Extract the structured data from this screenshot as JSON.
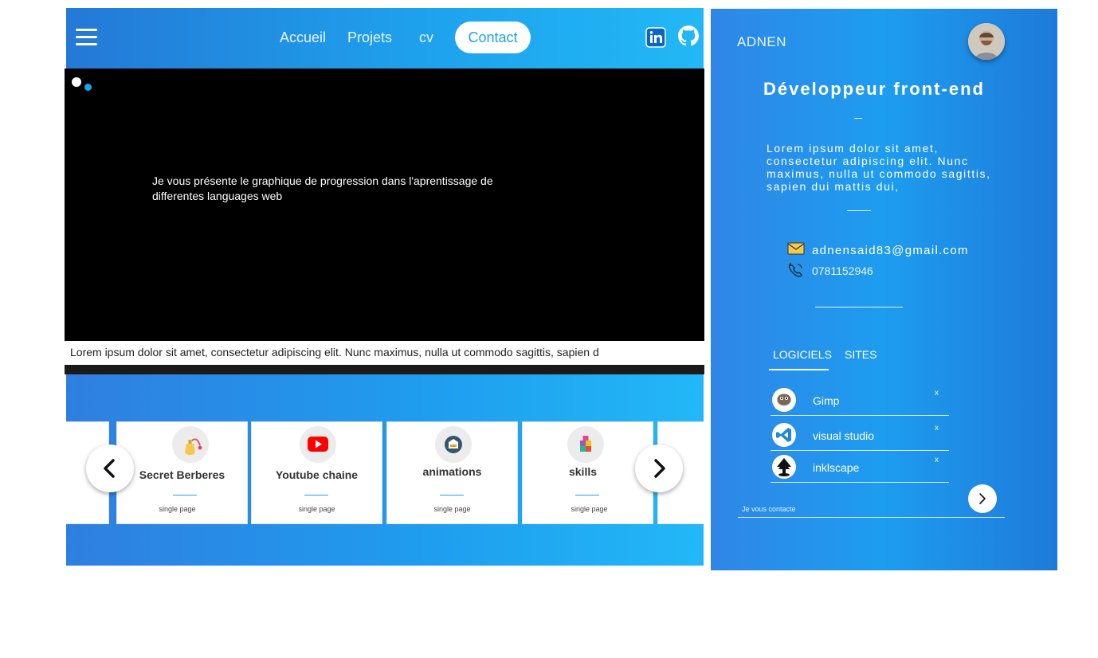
{
  "nav": {
    "links": [
      "Accueil",
      "Projets",
      "cv"
    ],
    "contact_label": "Contact",
    "social": [
      "linkedin-icon",
      "github-icon"
    ]
  },
  "video": {
    "text": "Je vous présente le graphique de progression dans l'aprentissage de differentes languages web",
    "caption": "Lorem ipsum dolor sit amet, consectetur adipiscing elit. Nunc maximus, nulla ut commodo sagittis, sapien d"
  },
  "carousel": {
    "cards": [
      {
        "title": "Secret Berberes",
        "subtitle": "single page",
        "icon": "perfume-icon"
      },
      {
        "title": "Youtube chaine",
        "subtitle": "single page",
        "icon": "youtube-icon"
      },
      {
        "title": "animations",
        "subtitle": "single page",
        "icon": "box-icon"
      },
      {
        "title": "skills",
        "subtitle": "single page",
        "icon": "blocks-icon"
      }
    ]
  },
  "profile": {
    "brand": "ADNEN",
    "role": "Développeur front-end",
    "bio": "Lorem ipsum dolor sit amet, consectetur adipiscing elit. Nunc maximus, nulla ut commodo sagittis, sapien dui mattis dui,",
    "email": "adnensaid83@gmail.com",
    "phone": "0781152946"
  },
  "tabs": [
    "LOGICIELS",
    "SITES"
  ],
  "software": [
    {
      "name": "Gimp",
      "remove": "x",
      "icon": "gimp-icon"
    },
    {
      "name": "visual studio",
      "remove": "x",
      "icon": "vscode-icon"
    },
    {
      "name": "inklscape",
      "remove": "x",
      "icon": "inkscape-icon"
    }
  ],
  "contact": {
    "placeholder": "Je vous contacte"
  },
  "colors": {
    "accent": "#1aa3f2",
    "panel_start": "#2479d6",
    "panel_end": "#22b8f5"
  }
}
